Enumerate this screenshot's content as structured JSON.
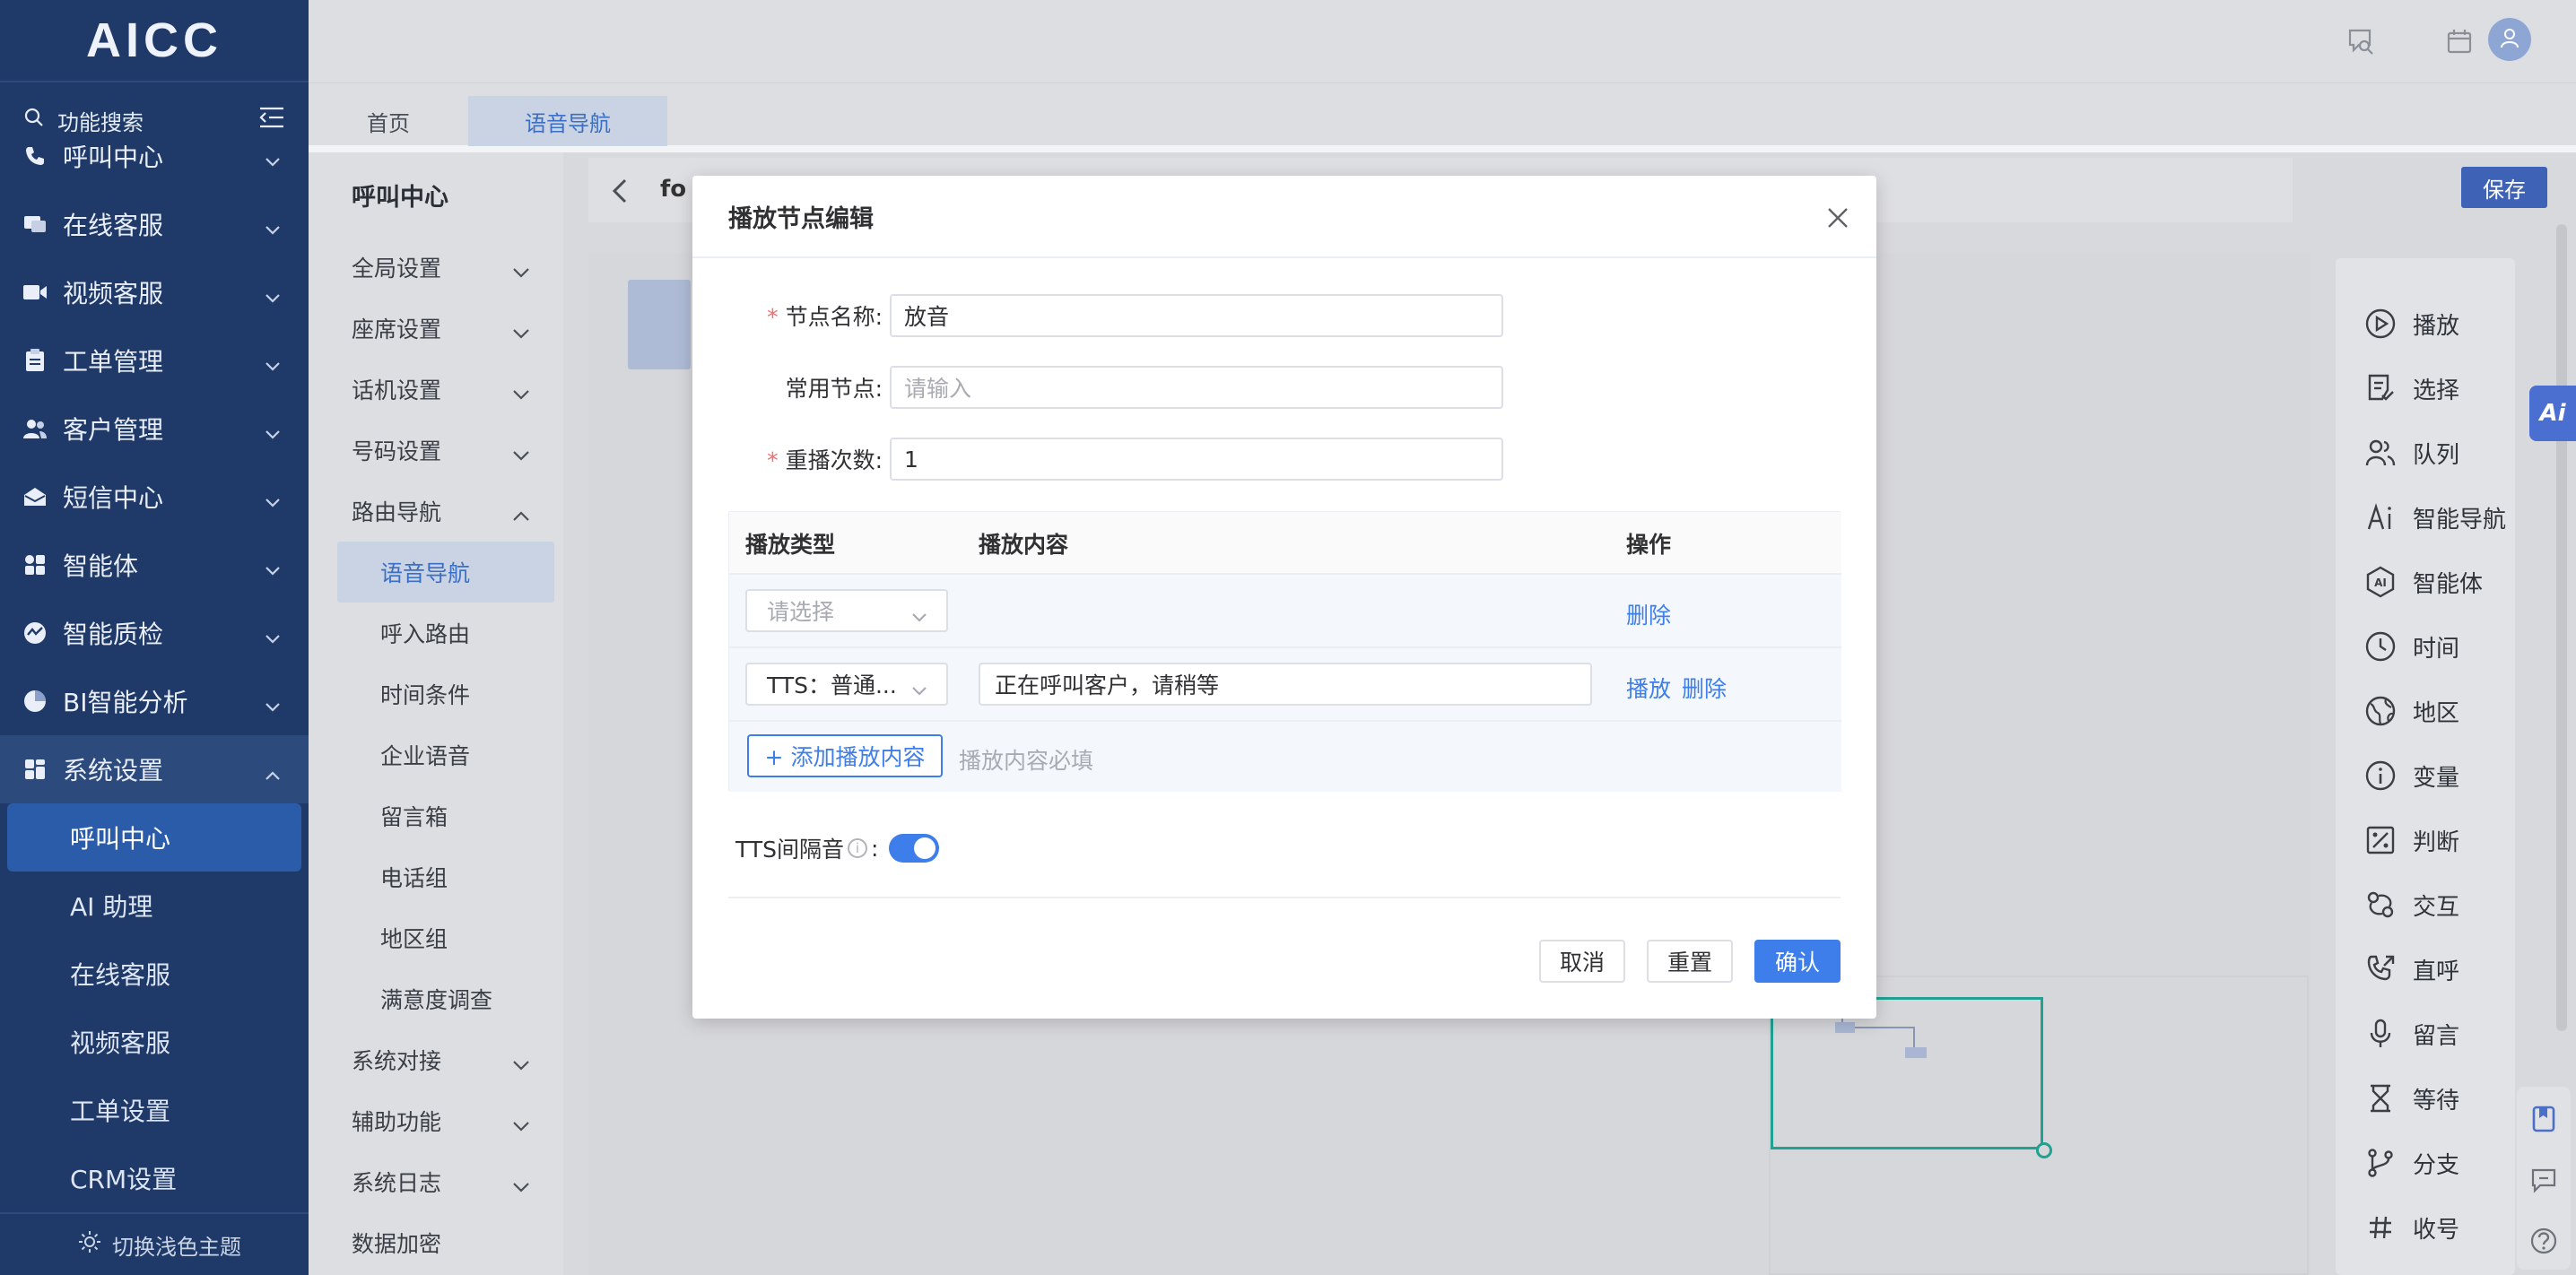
{
  "app": {
    "logo": "AICC"
  },
  "search": {
    "label": "功能搜索"
  },
  "sidebar": {
    "items": [
      {
        "label": "呼叫中心",
        "icon": "phone-icon"
      },
      {
        "label": "在线客服",
        "icon": "chat-icon"
      },
      {
        "label": "视频客服",
        "icon": "video-icon"
      },
      {
        "label": "工单管理",
        "icon": "clipboard-icon"
      },
      {
        "label": "客户管理",
        "icon": "users-icon"
      },
      {
        "label": "短信中心",
        "icon": "mail-icon"
      },
      {
        "label": "智能体",
        "icon": "grid-icon"
      },
      {
        "label": "智能质检",
        "icon": "quality-icon"
      },
      {
        "label": "BI智能分析",
        "icon": "pie-icon"
      },
      {
        "label": "系统设置",
        "icon": "settings-grid-icon"
      }
    ],
    "sub_items": [
      "呼叫中心",
      "AI 助理",
      "在线客服",
      "视频客服",
      "工单设置",
      "CRM设置"
    ],
    "theme_toggle": "切换浅色主题"
  },
  "tabs": [
    {
      "label": "首页"
    },
    {
      "label": "语音导航"
    }
  ],
  "subnav": {
    "title": "呼叫中心",
    "items": [
      {
        "label": "全局设置",
        "chev": "down"
      },
      {
        "label": "座席设置",
        "chev": "down"
      },
      {
        "label": "话机设置",
        "chev": "down"
      },
      {
        "label": "号码设置",
        "chev": "down"
      },
      {
        "label": "路由导航",
        "chev": "up"
      },
      {
        "label": "语音导航",
        "child": true,
        "current": true
      },
      {
        "label": "呼入路由",
        "child": true
      },
      {
        "label": "时间条件",
        "child": true
      },
      {
        "label": "企业语音",
        "child": true
      },
      {
        "label": "留言箱",
        "child": true
      },
      {
        "label": "电话组",
        "child": true
      },
      {
        "label": "地区组",
        "child": true
      },
      {
        "label": "满意度调查",
        "child": true
      },
      {
        "label": "系统对接",
        "chev": "down"
      },
      {
        "label": "辅助功能",
        "chev": "down"
      },
      {
        "label": "系统日志",
        "chev": "down"
      },
      {
        "label": "数据加密"
      }
    ]
  },
  "flow": {
    "name_fragment": "fo",
    "save_label": "保存"
  },
  "palette": [
    {
      "label": "播放",
      "icon": "play-icon"
    },
    {
      "label": "选择",
      "icon": "select-icon"
    },
    {
      "label": "队列",
      "icon": "queue-icon"
    },
    {
      "label": "智能导航",
      "icon": "ai-nav-icon"
    },
    {
      "label": "智能体",
      "icon": "agent-icon"
    },
    {
      "label": "时间",
      "icon": "clock-icon"
    },
    {
      "label": "地区",
      "icon": "globe-icon"
    },
    {
      "label": "变量",
      "icon": "info-icon"
    },
    {
      "label": "判断",
      "icon": "percent-icon"
    },
    {
      "label": "交互",
      "icon": "interact-icon"
    },
    {
      "label": "直呼",
      "icon": "direct-call-icon"
    },
    {
      "label": "留言",
      "icon": "mic-icon"
    },
    {
      "label": "等待",
      "icon": "hourglass-icon"
    },
    {
      "label": "分支",
      "icon": "branch-icon"
    },
    {
      "label": "收号",
      "icon": "hash-icon"
    }
  ],
  "ai_badge": "Ai",
  "modal": {
    "title": "播放节点编辑",
    "fields": {
      "node_name": {
        "label": "节点名称:",
        "value": "放音"
      },
      "common_node": {
        "label": "常用节点:",
        "placeholder": "请输入"
      },
      "replay_count": {
        "label": "重播次数:",
        "value": "1"
      }
    },
    "table": {
      "headers": {
        "type": "播放类型",
        "content": "播放内容",
        "action": "操作"
      },
      "row1": {
        "type_placeholder": "请选择",
        "delete": "删除"
      },
      "row2": {
        "type_value": "TTS：普通...",
        "content": "正在呼叫客户，请稍等",
        "play": "播放",
        "delete": "删除"
      },
      "add_button": "+ 添加播放内容",
      "add_hint": "播放内容必填"
    },
    "tts_interval": {
      "label": "TTS间隔音",
      "colon": ":",
      "enabled": true
    },
    "buttons": {
      "cancel": "取消",
      "reset": "重置",
      "confirm": "确认"
    }
  }
}
